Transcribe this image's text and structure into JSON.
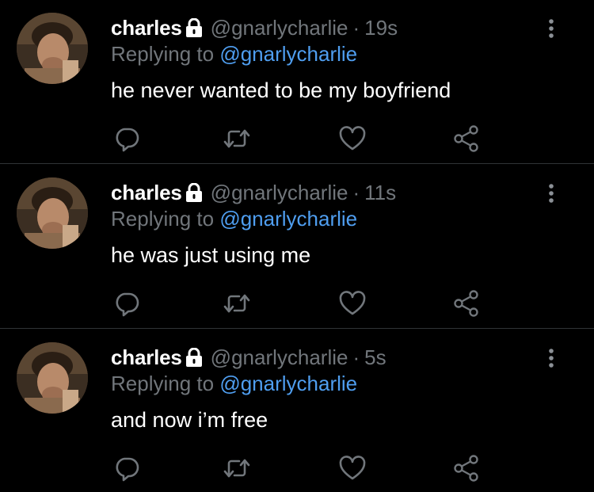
{
  "tweets": [
    {
      "name": "charles",
      "handle": "@gnarlycharlie",
      "separator": "·",
      "time": "19s",
      "replying_prefix": "Replying to",
      "replying_to": "@gnarlycharlie",
      "text": "he never wanted to be my boyfriend"
    },
    {
      "name": "charles",
      "handle": "@gnarlycharlie",
      "separator": "·",
      "time": "11s",
      "replying_prefix": "Replying to",
      "replying_to": "@gnarlycharlie",
      "text": "he was just using me"
    },
    {
      "name": "charles",
      "handle": "@gnarlycharlie",
      "separator": "·",
      "time": "5s",
      "replying_prefix": "Replying to",
      "replying_to": "@gnarlycharlie",
      "text": "and now i’m free"
    }
  ],
  "icons": {
    "protected": "lock-icon",
    "more": "more-vertical-icon",
    "reply": "reply-icon",
    "retweet": "retweet-icon",
    "like": "heart-icon",
    "share": "share-icon"
  },
  "colors": {
    "background": "#000000",
    "text": "#ffffff",
    "muted": "#71767b",
    "link": "#4f9ef0",
    "divider": "#2f3336"
  }
}
